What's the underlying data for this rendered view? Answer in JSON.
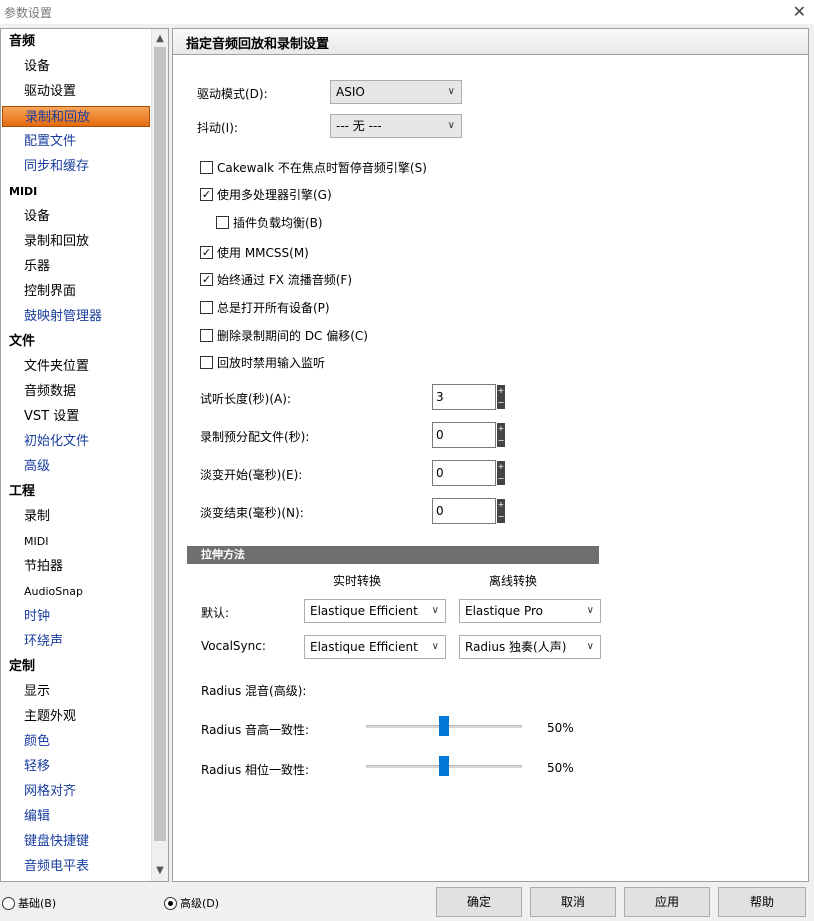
{
  "window": {
    "title": "参数设置",
    "close_glyph": "✕"
  },
  "sidebar": {
    "items": [
      {
        "label": "音频",
        "kind": "header"
      },
      {
        "label": "设备",
        "kind": "child"
      },
      {
        "label": "驱动设置",
        "kind": "child"
      },
      {
        "label": "录制和回放",
        "kind": "child",
        "selected": true
      },
      {
        "label": "配置文件",
        "kind": "child",
        "link": true
      },
      {
        "label": "同步和缓存",
        "kind": "child",
        "link": true
      },
      {
        "label": "MIDI",
        "kind": "header",
        "latin": true
      },
      {
        "label": "设备",
        "kind": "child"
      },
      {
        "label": "录制和回放",
        "kind": "child"
      },
      {
        "label": "乐器",
        "kind": "child"
      },
      {
        "label": "控制界面",
        "kind": "child"
      },
      {
        "label": "鼓映射管理器",
        "kind": "child",
        "link": true
      },
      {
        "label": "文件",
        "kind": "header"
      },
      {
        "label": "文件夹位置",
        "kind": "child"
      },
      {
        "label": "音频数据",
        "kind": "child"
      },
      {
        "label": "VST 设置",
        "kind": "child"
      },
      {
        "label": "初始化文件",
        "kind": "child",
        "link": true
      },
      {
        "label": "高级",
        "kind": "child",
        "link": true
      },
      {
        "label": "工程",
        "kind": "header"
      },
      {
        "label": "录制",
        "kind": "child"
      },
      {
        "label": "MIDI",
        "kind": "child",
        "latin": true
      },
      {
        "label": "节拍器",
        "kind": "child"
      },
      {
        "label": "AudioSnap",
        "kind": "child",
        "latin": true
      },
      {
        "label": "时钟",
        "kind": "child",
        "link": true
      },
      {
        "label": "环绕声",
        "kind": "child",
        "link": true
      },
      {
        "label": "定制",
        "kind": "header"
      },
      {
        "label": "显示",
        "kind": "child"
      },
      {
        "label": "主题外观",
        "kind": "child"
      },
      {
        "label": "颜色",
        "kind": "child",
        "link": true
      },
      {
        "label": "轻移",
        "kind": "child",
        "link": true
      },
      {
        "label": "网格对齐",
        "kind": "child",
        "link": true
      },
      {
        "label": "编辑",
        "kind": "child",
        "link": true
      },
      {
        "label": "键盘快捷键",
        "kind": "child",
        "link": true
      },
      {
        "label": "音频电平表",
        "kind": "child",
        "link": true
      }
    ]
  },
  "panel": {
    "title": "指定音频回放和录制设置",
    "driver_mode": {
      "label": "驱动模式(D):",
      "value": "ASIO"
    },
    "dither": {
      "label": "抖动(I):",
      "value": "--- 无 ---"
    },
    "checkboxes": [
      {
        "label": "Cakewalk 不在焦点时暂停音频引擎(S)",
        "checked": false
      },
      {
        "label": "使用多处理器引擎(G)",
        "checked": true
      },
      {
        "label": "插件负载均衡(B)",
        "checked": false
      },
      {
        "label": "使用 MMCSS(M)",
        "checked": true
      },
      {
        "label": "始终通过 FX 流播音频(F)",
        "checked": true
      },
      {
        "label": "总是打开所有设备(P)",
        "checked": false
      },
      {
        "label": "删除录制期间的 DC 偏移(C)",
        "checked": false
      },
      {
        "label": "回放时禁用输入监听",
        "checked": false
      }
    ],
    "spinners": [
      {
        "label": "试听长度(秒)(A):",
        "value": "3"
      },
      {
        "label": "录制预分配文件(秒):",
        "value": "0"
      },
      {
        "label": "淡变开始(毫秒)(E):",
        "value": "0"
      },
      {
        "label": "淡变结束(毫秒)(N):",
        "value": "0"
      }
    ],
    "stretch": {
      "header": "拉伸方法",
      "col_realtime": "实时转换",
      "col_offline": "离线转换",
      "default_label": "默认:",
      "default_realtime": "Elastique Efficient",
      "default_offline": "Elastique Pro",
      "vocalsync_label": "VocalSync:",
      "vocalsync_realtime": "Elastique Efficient",
      "vocalsync_offline": "Radius 独奏(人声)",
      "radius_mix_label": "Radius 混音(高级):",
      "pitch_label": "Radius 音高一致性:",
      "pitch_value": 0.5,
      "pitch_text": "50%",
      "phase_label": "Radius 相位一致性:",
      "phase_value": 0.5,
      "phase_text": "50%"
    }
  },
  "bottom": {
    "basic_label": "基础(B)",
    "advanced_label": "高级(D)",
    "selected_mode": "advanced",
    "ok_label": "确定",
    "cancel_label": "取消",
    "apply_label": "应用",
    "help_label": "帮助"
  },
  "icons": {
    "dropdown": "chevron-down-icon",
    "check": "✓"
  }
}
